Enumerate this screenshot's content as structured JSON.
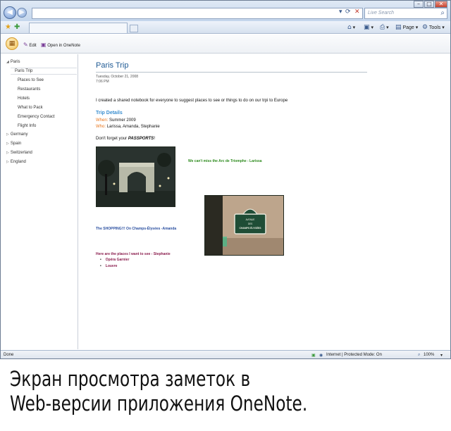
{
  "browser": {
    "window_buttons": [
      "–",
      "□",
      "✕"
    ],
    "search_placeholder": "Live Search",
    "command_bar": {
      "page_label": "Page ▾",
      "tools_label": "Tools ▾"
    },
    "status": {
      "left": "Done",
      "zone": "Internet | Protected Mode: On",
      "zoom": "100%"
    }
  },
  "onenote": {
    "toolbar": {
      "edit_label": "Edit",
      "open_label": "Open in OneNote"
    },
    "nav": {
      "notebook": "Paris",
      "pages": [
        "Paris Trip",
        "Places to See",
        "Restaurants",
        "Hotels",
        "What to Pack",
        "Emergency Contact",
        "Flight Info"
      ],
      "selected_index": 0,
      "sections": [
        "Germany",
        "Spain",
        "Switzerland",
        "England"
      ]
    },
    "page": {
      "title": "Paris Trip",
      "date": "Tuesday, October 21, 2008",
      "time": "7:06 PM",
      "intro": "I created a shared notebook for everyone to suggest places to see or things to do on our trpi to Europe",
      "details_heading": "Trip Details",
      "when_label": "When:",
      "when_value": "Summer 2009",
      "who_label": "Who:",
      "who_value": "Larissa, Amanda, Stephanie",
      "reminder_pre": "Don't forget your ",
      "reminder_bold": "PASSPORTS",
      "reminder_post": "!",
      "caption1": "We can't miss the Arc de Triomphe - Larissa",
      "caption2": "The SHOPPING!!! On Champs-Élysées -Amanda",
      "sign_line1": "AVENUE",
      "sign_line2": "DES",
      "sign_line3": "CHAMPS ÉLYSÉES",
      "places_heading": "Here are the places I want to see - Stephanie",
      "places": [
        "Opéra Garnier",
        "Louvre"
      ]
    }
  },
  "caption": {
    "line1": "Экран просмотра заметок в",
    "line2": "Web-версии приложения OneNote."
  },
  "colors": {
    "title_blue": "#1f5a94",
    "label_orange": "#e8751b",
    "caption_green": "#2e8b1e",
    "caption_blue": "#2a4fa0",
    "places_maroon": "#8b1e4e"
  }
}
